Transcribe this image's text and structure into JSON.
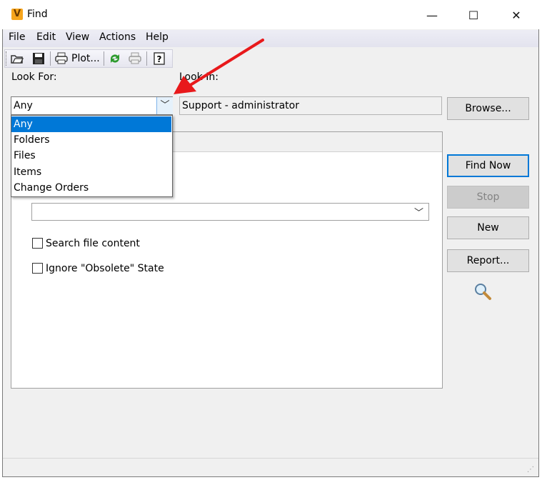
{
  "window": {
    "title": "Find",
    "app_icon_letter": "V"
  },
  "window_controls": {
    "minimize": "—",
    "maximize": "☐",
    "close": "✕"
  },
  "menu": [
    "File",
    "Edit",
    "View",
    "Actions",
    "Help"
  ],
  "toolbar": {
    "plot_label": "Plot..."
  },
  "look_for": {
    "label": "Look For:",
    "value": "Any",
    "options": [
      "Any",
      "Folders",
      "Files",
      "Items",
      "Change Orders"
    ],
    "selected_index": 0
  },
  "look_in": {
    "label": "Look In:",
    "value": "Support - administrator"
  },
  "buttons": {
    "browse": "Browse...",
    "find_now": "Find Now",
    "stop": "Stop",
    "new": "New",
    "report": "Report..."
  },
  "options": {
    "search_file_content": {
      "label": "Search file content",
      "checked": false
    },
    "ignore_obsolete": {
      "label": "Ignore \"Obsolete\" State",
      "checked": false
    }
  },
  "colors": {
    "selection": "#0078d7",
    "annotation_arrow": "#e8191b",
    "app_icon": "#f7a51c"
  }
}
